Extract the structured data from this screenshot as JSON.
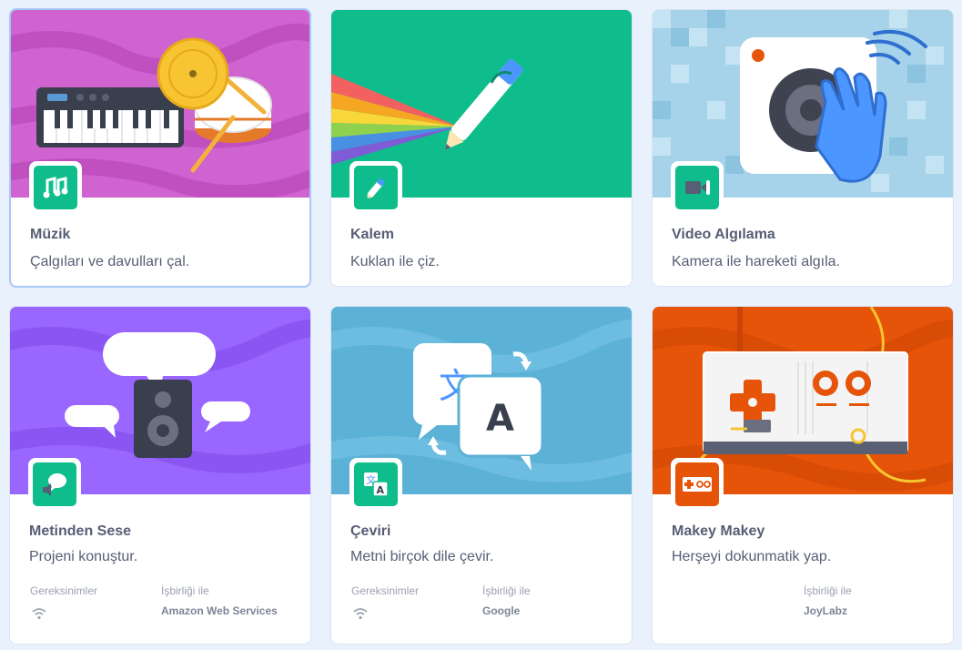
{
  "cards": [
    {
      "title": "Müzik",
      "desc": "Çalgıları ve davulları çal."
    },
    {
      "title": "Kalem",
      "desc": "Kuklan ile çiz."
    },
    {
      "title": "Video Algılama",
      "desc": "Kamera ile hareketi algıla."
    },
    {
      "title": "Metinden Sese",
      "desc": "Projeni konuştur.",
      "requirements_label": "Gereksinimler",
      "collab_label": "İşbirliği ile",
      "collab_value": "Amazon Web Services"
    },
    {
      "title": "Çeviri",
      "desc": "Metni birçok dile çevir.",
      "requirements_label": "Gereksinimler",
      "collab_label": "İşbirliği ile",
      "collab_value": "Google"
    },
    {
      "title": "Makey Makey",
      "desc": "Herşeyi dokunmatik yap.",
      "collab_label": "İşbirliği ile",
      "collab_value": "JoyLabz"
    }
  ],
  "colors": {
    "music_bg": "#cf63cf",
    "pen_bg": "#0fbd8c",
    "video_bg": "#a6d3ea",
    "tts_bg": "#9966ff",
    "translate_bg": "#5cb1d6",
    "makey_bg": "#e6540a",
    "badge_green": "#0fbd8c"
  }
}
